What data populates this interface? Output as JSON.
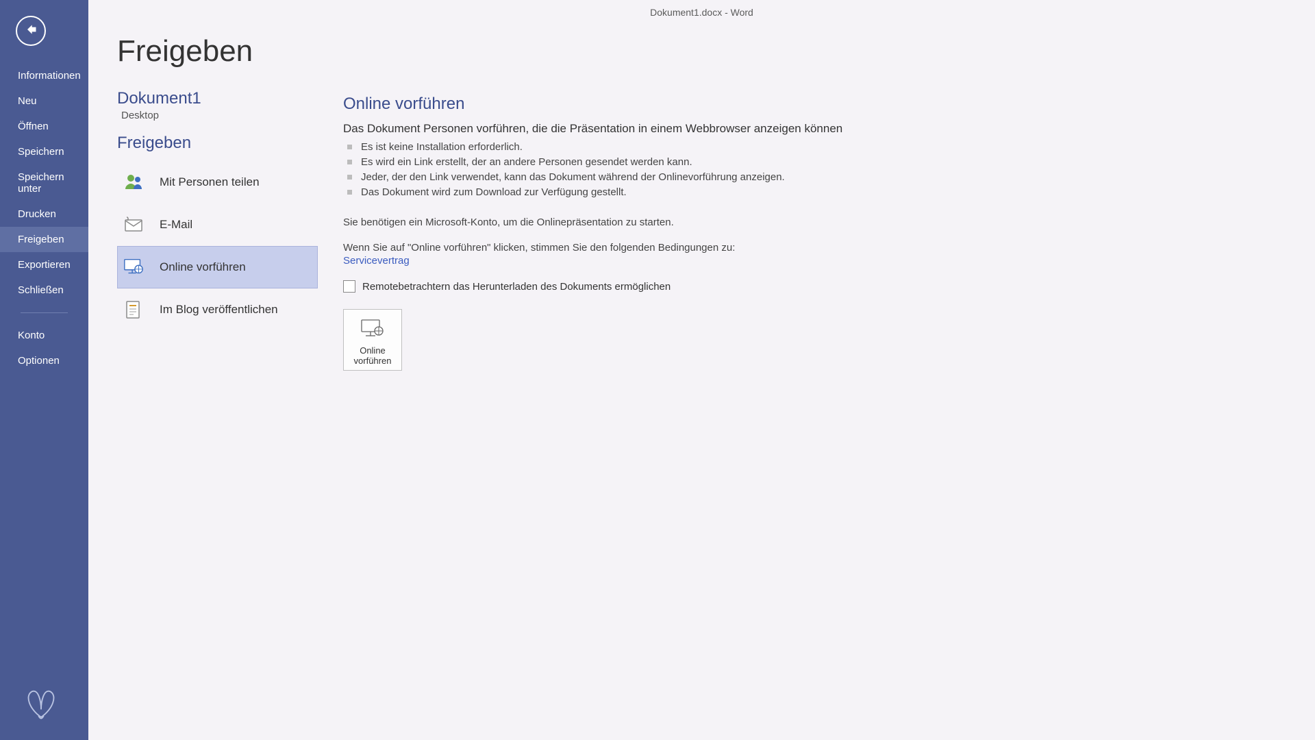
{
  "window_title": "Dokument1.docx - Word",
  "sidebar": {
    "items": [
      {
        "label": "Informationen",
        "active": false
      },
      {
        "label": "Neu",
        "active": false
      },
      {
        "label": "Öffnen",
        "active": false
      },
      {
        "label": "Speichern",
        "active": false
      },
      {
        "label": "Speichern unter",
        "active": false
      },
      {
        "label": "Drucken",
        "active": false
      },
      {
        "label": "Freigeben",
        "active": true
      },
      {
        "label": "Exportieren",
        "active": false
      },
      {
        "label": "Schließen",
        "active": false
      }
    ],
    "items2": [
      {
        "label": "Konto"
      },
      {
        "label": "Optionen"
      }
    ]
  },
  "page_title": "Freigeben",
  "document": {
    "name": "Dokument1",
    "location": "Desktop"
  },
  "share": {
    "heading": "Freigeben",
    "options": [
      {
        "label": "Mit Personen teilen",
        "icon": "people-icon",
        "selected": false
      },
      {
        "label": "E-Mail",
        "icon": "mail-icon",
        "selected": false
      },
      {
        "label": "Online vorführen",
        "icon": "present-icon",
        "selected": true
      },
      {
        "label": "Im Blog veröffentlichen",
        "icon": "blog-icon",
        "selected": false
      }
    ]
  },
  "detail": {
    "heading": "Online vorführen",
    "lead": "Das Dokument Personen vorführen, die die Präsentation in einem Webbrowser anzeigen können",
    "bullets": [
      "Es ist keine Installation erforderlich.",
      "Es wird ein Link erstellt, der an andere Personen gesendet werden kann.",
      "Jeder, der den Link verwendet, kann das Dokument während der Onlinevorführung anzeigen.",
      "Das Dokument wird zum Download zur Verfügung gestellt."
    ],
    "note": "Sie benötigen ein Microsoft-Konto, um die Onlinepräsentation zu starten.",
    "terms_pre": "Wenn Sie auf \"Online vorführen\" klicken, stimmen Sie den folgenden Bedingungen zu:",
    "terms_link": "Servicevertrag",
    "checkbox_label": "Remotebetrachtern das Herunterladen des Dokuments ermöglichen",
    "button_line1": "Online",
    "button_line2": "vorführen"
  }
}
